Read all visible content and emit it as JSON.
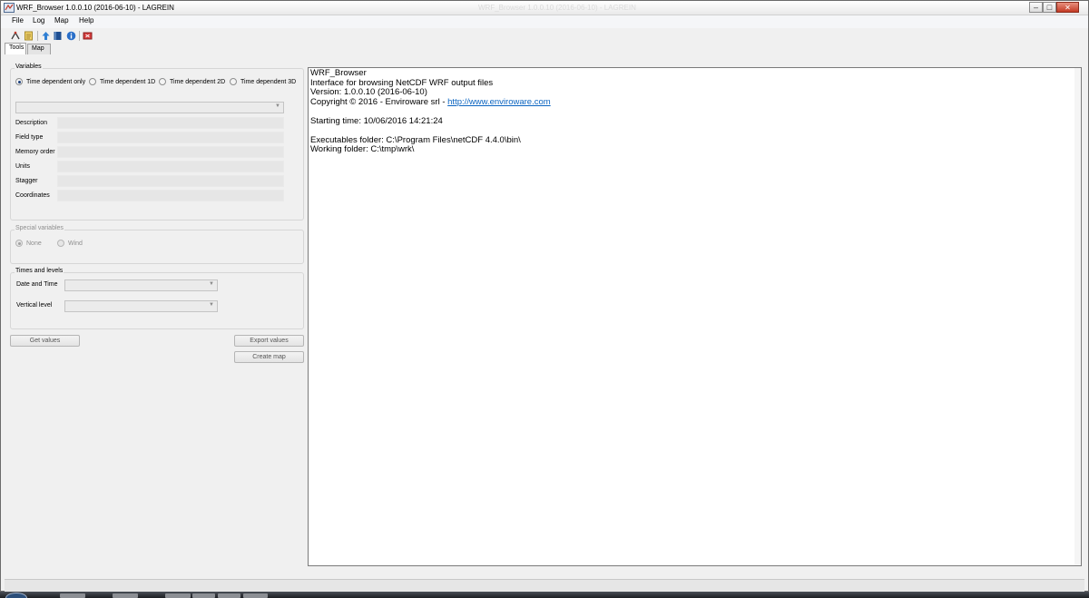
{
  "window": {
    "title": "WRF_Browser 1.0.0.10 (2016-06-10) - LAGREIN",
    "ghost_title": "WRF_Browser 1.0.0.10 (2016-06-10) - LAGREIN",
    "controls": {
      "minimize": "–",
      "maximize": "□",
      "close": "✕"
    }
  },
  "menu": [
    "File",
    "Log",
    "Map",
    "Help"
  ],
  "toolbar": {
    "buttons": [
      "open-icon",
      "notes-icon",
      "upload-icon",
      "book-icon",
      "info-icon",
      "exit-icon"
    ]
  },
  "tabs": [
    {
      "label": "Tools",
      "active": true
    },
    {
      "label": "Map",
      "active": false
    }
  ],
  "variables": {
    "title": "Variables",
    "options": [
      {
        "label": "Time dependent only",
        "checked": true
      },
      {
        "label": "Time dependent 1D",
        "checked": false
      },
      {
        "label": "Time dependent 2D",
        "checked": false
      },
      {
        "label": "Time dependent 3D",
        "checked": false
      }
    ],
    "selected_variable": "",
    "fields": [
      {
        "label": "Description",
        "value": ""
      },
      {
        "label": "Field type",
        "value": ""
      },
      {
        "label": "Memory order",
        "value": ""
      },
      {
        "label": "Units",
        "value": ""
      },
      {
        "label": "Stagger",
        "value": ""
      },
      {
        "label": "Coordinates",
        "value": ""
      }
    ]
  },
  "special_variables": {
    "title": "Special variables",
    "options": [
      {
        "label": "None",
        "checked": true
      },
      {
        "label": "Wind",
        "checked": false
      }
    ]
  },
  "times_levels": {
    "title": "Times and levels",
    "date_time_label": "Date and Time",
    "date_time_value": "",
    "vertical_level_label": "Vertical level",
    "vertical_level_value": ""
  },
  "buttons": {
    "get_values": "Get values",
    "export_values": "Export values",
    "create_map": "Create map"
  },
  "log": {
    "app_name": "WRF_Browser",
    "description": "Interface for browsing NetCDF WRF output files",
    "version": "Version: 1.0.0.10 (2016-06-10)",
    "copyright_prefix": "Copyright ©  2016 - Enviroware srl - ",
    "link": "http://www.enviroware.com",
    "starting_time": "Starting time: 10/06/2016 14:21:24",
    "executables_folder": "Executables folder: C:\\Program Files\\netCDF 4.4.0\\bin\\",
    "working_folder": "Working folder: C:\\tmp\\wrk\\"
  },
  "status": ""
}
